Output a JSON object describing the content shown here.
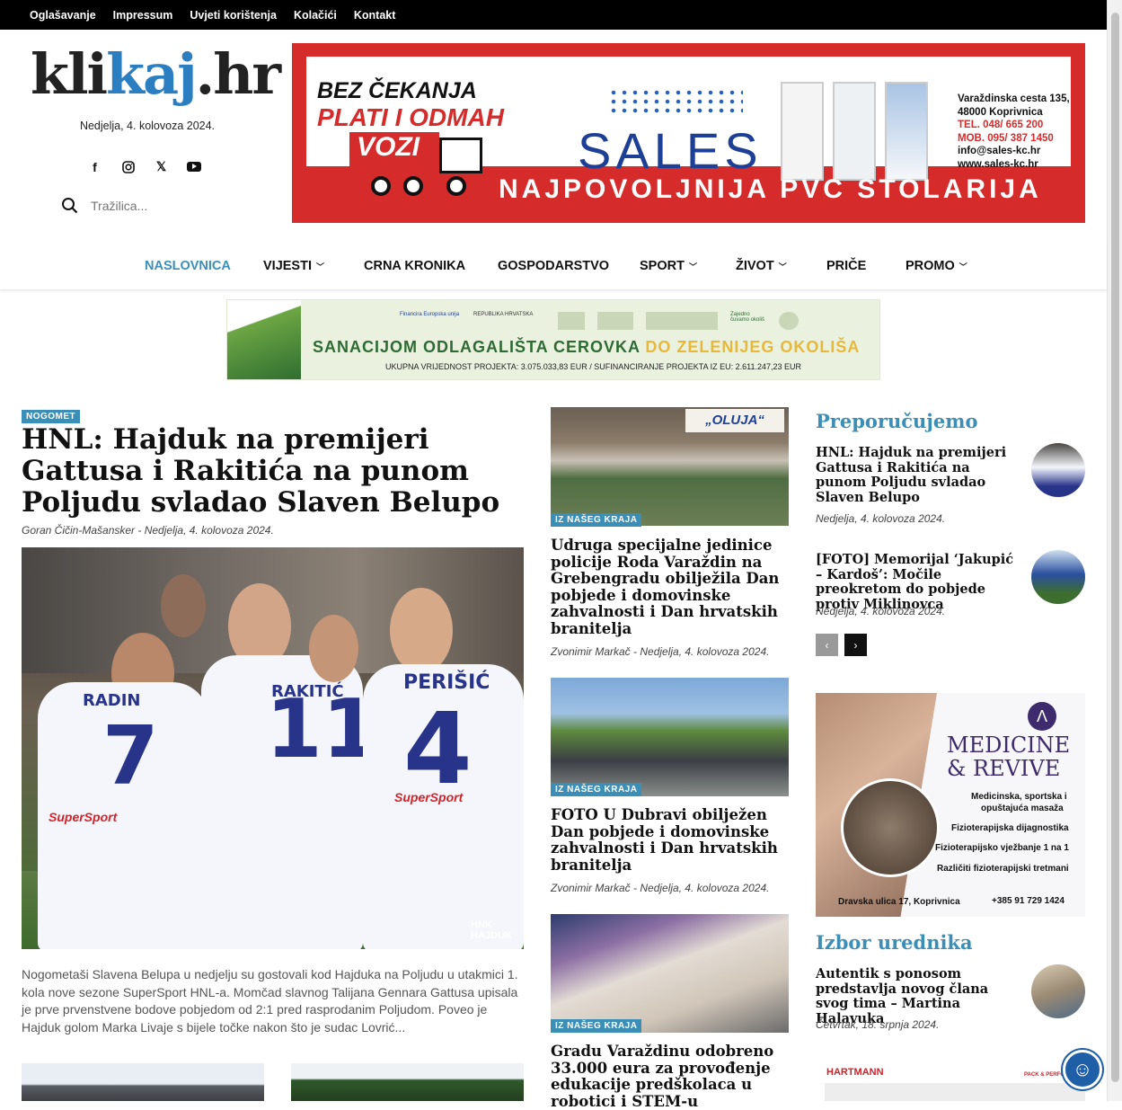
{
  "topbar": {
    "links": [
      "Oglašavanje",
      "Impressum",
      "Uvjeti korištenja",
      "Kolačići",
      "Kontakt"
    ]
  },
  "logo": {
    "part1": "kli",
    "part2": "kaj",
    "part3": ".hr"
  },
  "header_date": "Nedjelja, 4. kolovoza 2024.",
  "social_icons": [
    "facebook-icon",
    "instagram-icon",
    "x-icon",
    "youtube-icon"
  ],
  "search": {
    "placeholder": "Tražilica..."
  },
  "ad_top": {
    "line1": "BEZ ČEKANJA",
    "line2": "PLATI I ODMAH",
    "line3": "VOZI",
    "brand": "SALES",
    "address1": "Varaždinska cesta 135,",
    "address2": "48000 Koprivnica",
    "tel": "TEL. 048/ 665 200",
    "mob": "MOB. 095/ 387 1450",
    "email": "info@sales-kc.hr",
    "web": "www.sales-kc.hr",
    "slogan": "NAJPOVOLJNIJA PVC STOLARIJA"
  },
  "nav": {
    "items": [
      {
        "label": "NASLOVNICA",
        "active": true
      },
      {
        "label": "VIJESTI",
        "dropdown": true
      },
      {
        "label": "CRNA KRONIKA"
      },
      {
        "label": "GOSPODARSTVO"
      },
      {
        "label": "SPORT",
        "dropdown": true
      },
      {
        "label": "ŽIVOT",
        "dropdown": true
      },
      {
        "label": "PRIČE"
      },
      {
        "label": "PROMO",
        "dropdown": true
      }
    ]
  },
  "ad_mid": {
    "title_a": "SANACIJOM ODLAGALIŠTA CEROVKA",
    "title_b": "DO ZELENIJEG OKOLIŠA",
    "subtitle": "UKUPNA VRIJEDNOST PROJEKTA: 3.075.033,83 EUR  /  SUFINANCIRANJE PROJEKTA IZ EU: 2.611.247,23 EUR",
    "logo1": "Financira Europska unija",
    "logo2": "REPUBLIKA HRVATSKA",
    "logo3": "Zajedno čuvamo okoliš"
  },
  "main_article": {
    "tag": "NOGOMET",
    "title": "HNL: Hajduk na premijeri Gattusa i Rakitića na punom Poljudu svladao Slaven Belupo",
    "author": "Goran Čičin-Mašansker",
    "date": "Nedjelja, 4. kolovoza 2024.",
    "excerpt": "Nogometaši Slavena Belupa u nedjelju su gostovali kod Hajduka na Poljudu u utakmici 1. kola nove sezone SuperSport HNL-a. Momčad slavnog Talijana Gennara Gattusa upisala je prve prvenstvene bodove pobjedom od 2:1 pred rasprodanim Poljudom. Poveo je Hajduk golom Marka Livaje s bijele točke nakon što je sudac Lovrić...",
    "image_text": {
      "name_left": "RADIN",
      "name_mid": "RAKITIĆ",
      "name_right": "PERIŠIĆ",
      "num_left": "7",
      "num_mid": "11",
      "num_right": "4",
      "sponsor": "SuperSport",
      "watermark": "HNK HAJDUK"
    }
  },
  "middle_articles": [
    {
      "tag": "IZ NAŠEG KRAJA",
      "title": "Udruga specijalne jedinice policije Roda Varaždin na Grebengradu obilježila Dan pobjede i domovinske zahvalnosti i Dan hrvatskih branitelja",
      "author": "Zvonimir Markač",
      "date": "Nedjelja, 4. kolovoza 2024.",
      "sign": "„OLUJA“"
    },
    {
      "tag": "IZ NAŠEG KRAJA",
      "title": "FOTO U Dubravi obilježen Dan pobjede i domovinske zahvalnosti i Dan hrvatskih branitelja",
      "author": "Zvonimir Markač",
      "date": "Nedjelja, 4. kolovoza 2024."
    },
    {
      "tag": "IZ NAŠEG KRAJA",
      "title": "Gradu Varaždinu odobreno 33.000 eura za provođenje edukacije predškolaca u robotici i STEM-u"
    }
  ],
  "sidebar": {
    "recommended_heading": "Preporučujemo",
    "recommended": [
      {
        "title": "HNL: Hajduk na premijeri Gattusa i Rakitića na punom Poljudu svladao Slaven Belupo",
        "date": "Nedjelja, 4. kolovoza 2024."
      },
      {
        "title": "[FOTO] Memorijal ‘Jakupić – Kardoš’: Močile preokretom do pobjede protiv Miklinovca",
        "date": "Nedjelja, 4. kolovoza 2024."
      }
    ],
    "ad": {
      "brand1": "MEDICINE",
      "brand2": "& REVIVE",
      "s1": "Medicinska, sportska i",
      "s2": "opuštajuća masaža",
      "s3": "Fizioterapijska dijagnostika",
      "s4": "Fizioterapijsko vježbanje 1 na 1",
      "s5": "Različiti fizioterapijski tretmani",
      "address": "Dravska ulica 17, Koprivnica",
      "phone": "+385 91 729 1424"
    },
    "editors_heading": "Izbor urednika",
    "editors": [
      {
        "title": "Autentik s ponosom predstavlja novog člana svog tima – Martina Halavuka",
        "date": "Četvrtak, 18. srpnja 2024."
      }
    ],
    "bottom_ad": {
      "brand": "HARTMANN",
      "tag": "PACK & PERFO"
    }
  },
  "colors": {
    "accent": "#3b8fb6",
    "ad_red": "#d52b2b",
    "logo_blue": "#2b7fc1"
  }
}
